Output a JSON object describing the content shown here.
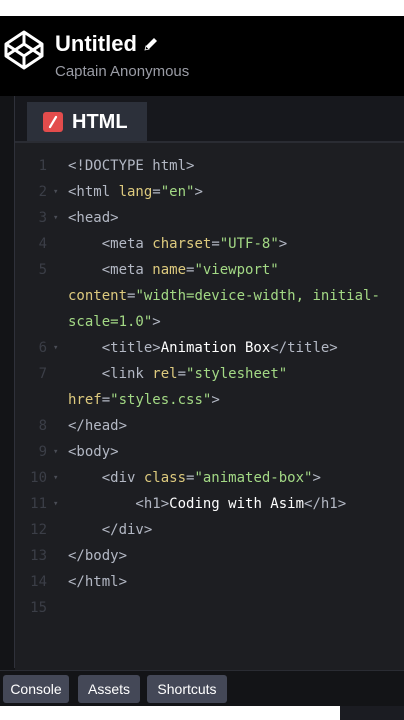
{
  "header": {
    "title": "Untitled",
    "author": "Captain Anonymous"
  },
  "editor": {
    "tab_label": "HTML",
    "lines": [
      {
        "n": "1",
        "fold": false,
        "parts": [
          [
            "tag",
            "<!DOCTYPE html>"
          ]
        ]
      },
      {
        "n": "2",
        "fold": true,
        "parts": [
          [
            "tag",
            "<html "
          ],
          [
            "attr",
            "lang"
          ],
          [
            "tag",
            "="
          ],
          [
            "str",
            "\"en\""
          ],
          [
            "tag",
            ">"
          ]
        ]
      },
      {
        "n": "3",
        "fold": true,
        "parts": [
          [
            "tag",
            "<head>"
          ]
        ]
      },
      {
        "n": "4",
        "fold": false,
        "parts": [
          [
            "tag",
            "    <meta "
          ],
          [
            "attr",
            "charset"
          ],
          [
            "tag",
            "="
          ],
          [
            "str",
            "\"UTF-8\""
          ],
          [
            "tag",
            ">"
          ]
        ]
      },
      {
        "n": "5",
        "fold": false,
        "parts": [
          [
            "tag",
            "    <meta "
          ],
          [
            "attr",
            "name"
          ],
          [
            "tag",
            "="
          ],
          [
            "str",
            "\"viewport\""
          ]
        ]
      },
      {
        "n": "",
        "fold": false,
        "parts": [
          [
            "attr",
            "content"
          ],
          [
            "tag",
            "="
          ],
          [
            "str",
            "\"width=device-width, initial-"
          ]
        ]
      },
      {
        "n": "",
        "fold": false,
        "parts": [
          [
            "str",
            "scale=1.0\""
          ],
          [
            "tag",
            ">"
          ]
        ]
      },
      {
        "n": "6",
        "fold": true,
        "parts": [
          [
            "tag",
            "    <title>"
          ],
          [
            "txt",
            "Animation Box"
          ],
          [
            "tag",
            "</title>"
          ]
        ]
      },
      {
        "n": "7",
        "fold": false,
        "parts": [
          [
            "tag",
            "    <link "
          ],
          [
            "attr",
            "rel"
          ],
          [
            "tag",
            "="
          ],
          [
            "str",
            "\"stylesheet\""
          ]
        ]
      },
      {
        "n": "",
        "fold": false,
        "parts": [
          [
            "attr",
            "href"
          ],
          [
            "tag",
            "="
          ],
          [
            "str",
            "\"styles.css\""
          ],
          [
            "tag",
            ">"
          ]
        ]
      },
      {
        "n": "8",
        "fold": false,
        "parts": [
          [
            "tag",
            "</head>"
          ]
        ]
      },
      {
        "n": "9",
        "fold": true,
        "parts": [
          [
            "tag",
            "<body>"
          ]
        ]
      },
      {
        "n": "10",
        "fold": true,
        "parts": [
          [
            "tag",
            "    <div "
          ],
          [
            "attr",
            "class"
          ],
          [
            "tag",
            "="
          ],
          [
            "str",
            "\"animated-box\""
          ],
          [
            "tag",
            ">"
          ]
        ]
      },
      {
        "n": "11",
        "fold": true,
        "parts": [
          [
            "tag",
            "        <h1>"
          ],
          [
            "txt",
            "Coding with Asim"
          ],
          [
            "tag",
            "</h1>"
          ]
        ]
      },
      {
        "n": "12",
        "fold": false,
        "parts": [
          [
            "tag",
            "    </div>"
          ]
        ]
      },
      {
        "n": "13",
        "fold": false,
        "parts": [
          [
            "tag",
            "</body>"
          ]
        ]
      },
      {
        "n": "14",
        "fold": false,
        "parts": [
          [
            "tag",
            "</html>"
          ]
        ]
      },
      {
        "n": "15",
        "fold": false,
        "parts": []
      }
    ]
  },
  "footer": {
    "buttons": [
      "Console",
      "Assets",
      "Shortcuts"
    ]
  },
  "colors": {
    "tag": "#b3b8c4",
    "attribute": "#ddca7e",
    "string": "#a3d985",
    "html_icon": "#e34c4c"
  }
}
